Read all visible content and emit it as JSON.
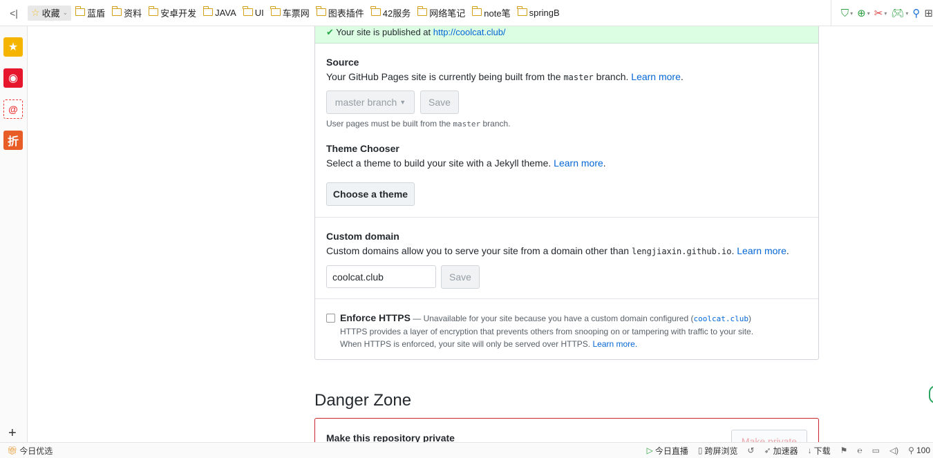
{
  "bookmarks": {
    "back_glyph": "<|",
    "favorites_label": "收藏",
    "folders": [
      "蓝盾",
      "资料",
      "安卓开发",
      "JAVA",
      "UI",
      "车票网",
      "图表插件",
      "42服务",
      "网络笔记",
      "note笔",
      "springB"
    ]
  },
  "banner": {
    "prefix": "Your site is published at ",
    "url": "http://coolcat.club/"
  },
  "source": {
    "title": "Source",
    "desc_before": "Your GitHub Pages site is currently being built from the ",
    "branch_code": "master",
    "desc_after": " branch. ",
    "learn_more": "Learn more",
    "period": ".",
    "branch_button": "master branch",
    "save_button": "Save",
    "note_before": "User pages must be built from the ",
    "note_code": "master",
    "note_after": " branch."
  },
  "theme": {
    "title": "Theme Chooser",
    "desc": "Select a theme to build your site with a Jekyll theme. ",
    "learn_more": "Learn more",
    "period": ".",
    "button": "Choose a theme"
  },
  "domain": {
    "title": "Custom domain",
    "desc_before": "Custom domains allow you to serve your site from a domain other than ",
    "domain_code": "lengjiaxin.github.io",
    "desc_after": ". ",
    "learn_more": "Learn more",
    "period": ".",
    "input_value": "coolcat.club",
    "save_button": "Save"
  },
  "https": {
    "title": "Enforce HTTPS",
    "dash_text": " — Unavailable for your site because you have a custom domain configured (",
    "domain_code": "coolcat.club",
    "close_paren": ")",
    "line1": "HTTPS provides a layer of encryption that prevents others from snooping on or tampering with traffic to your site.",
    "line2": "When HTTPS is enforced, your site will only be served over HTTPS. ",
    "learn_more": "Learn more."
  },
  "danger": {
    "title": "Danger Zone",
    "row_title": "Make this repository private",
    "button": "Make private"
  },
  "statusbar": {
    "left_label": "今日优选",
    "live_label": "今日直播",
    "cross_screen_label": "跨屏浏览",
    "accelerator_label": "加速器",
    "download_label": "下载",
    "zoom_label": "100"
  },
  "colors": {
    "link": "#0366d6",
    "banner_bg": "#dcffe4",
    "danger_border": "#cb2431"
  }
}
